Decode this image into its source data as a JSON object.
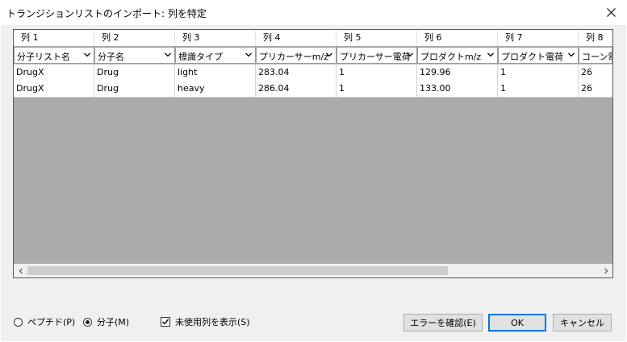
{
  "window": {
    "title": "トランジションリストのインポート: 列を特定"
  },
  "grid": {
    "column_names": [
      "列 1",
      "列 2",
      "列 3",
      "列 4",
      "列 5",
      "列 6",
      "列 7",
      "列 8"
    ],
    "column_types": [
      "分子リスト名",
      "分子名",
      "標識タイプ",
      "プリカーサーm/z",
      "プリカーサー電荷",
      "プロダクトm/z",
      "プロダクト電荷",
      "コーン電"
    ],
    "rows": [
      [
        "DrugX",
        "Drug",
        "light",
        "283.04",
        "1",
        "129.96",
        "1",
        "26"
      ],
      [
        "DrugX",
        "Drug",
        "heavy",
        "286.04",
        "1",
        "133.00",
        "1",
        "26"
      ]
    ]
  },
  "options": {
    "peptide_label": "ペプチド(P)",
    "molecule_label": "分子(M)",
    "molecule_selected": true,
    "show_unused_label": "未使用列を表示(S)",
    "show_unused_checked": true
  },
  "buttons": {
    "check_errors": "エラーを確認(E)",
    "ok": "OK",
    "cancel": "キャンセル"
  }
}
